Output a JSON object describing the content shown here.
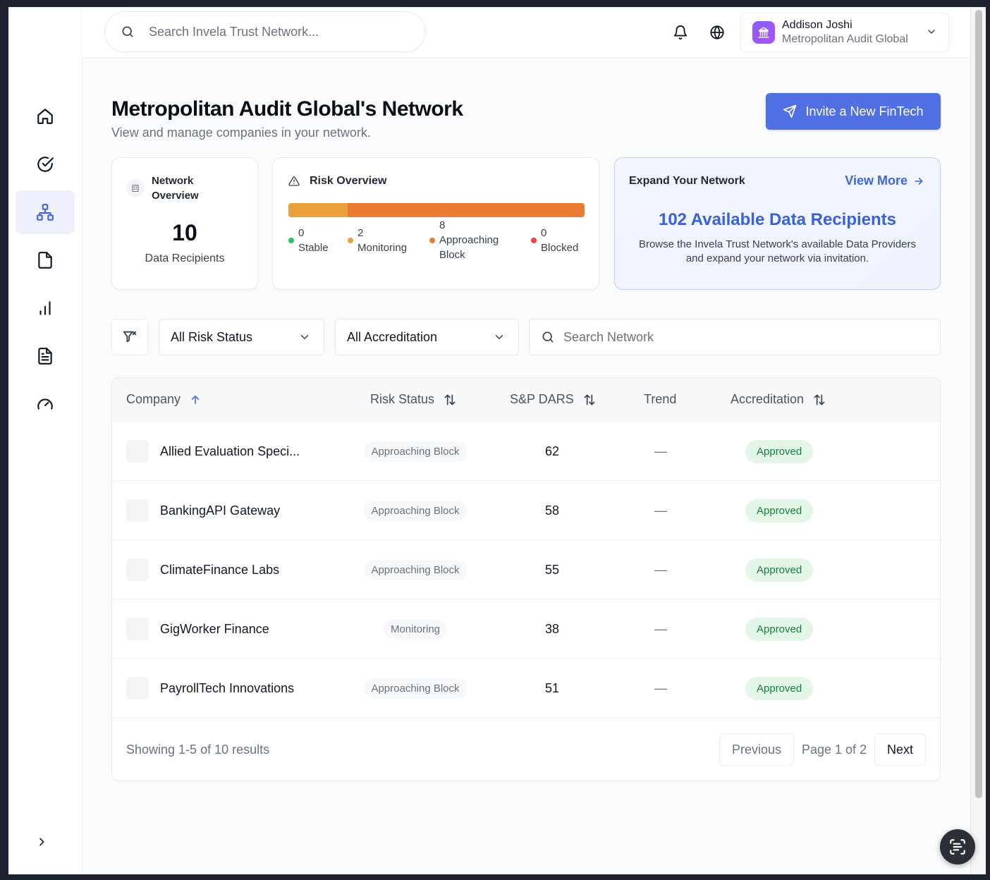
{
  "header": {
    "search_placeholder": "Search Invela Trust Network...",
    "user": {
      "name": "Addison Joshi",
      "org": "Metropolitan Audit Global"
    }
  },
  "sidebar": {
    "items": [
      {
        "icon": "home-icon",
        "active": false
      },
      {
        "icon": "check-circle-icon",
        "active": false
      },
      {
        "icon": "network-icon",
        "active": true
      },
      {
        "icon": "file-icon",
        "active": false
      },
      {
        "icon": "bar-chart-icon",
        "active": false
      },
      {
        "icon": "document-text-icon",
        "active": false
      },
      {
        "icon": "gauge-icon",
        "active": false
      }
    ]
  },
  "page": {
    "title": "Metropolitan Audit Global's Network",
    "subtitle": "View and manage companies in your network.",
    "invite_label": "Invite a New FinTech"
  },
  "network_overview": {
    "title_line1": "Network",
    "title_line2": "Overview",
    "count": "10",
    "label": "Data Recipients"
  },
  "risk_overview": {
    "title": "Risk Overview",
    "bar": [
      {
        "status": "Monitoring",
        "fraction": 0.2,
        "color": "#e9a23b"
      },
      {
        "status": "Approaching Block",
        "fraction": 0.8,
        "color": "#ea7b34"
      }
    ],
    "legend": [
      {
        "count": "0",
        "label": "Stable",
        "color": "#22c55e"
      },
      {
        "count": "2",
        "label": "Monitoring",
        "color": "#e9a23b"
      },
      {
        "count": "8",
        "label": "Approaching Block",
        "color": "#ea7b34"
      },
      {
        "count": "0",
        "label": "Blocked",
        "color": "#ef4444"
      }
    ]
  },
  "expand": {
    "title": "Expand Your Network",
    "view_more": "View More",
    "headline": "102 Available Data Recipients",
    "description": "Browse the Invela Trust Network's available Data Providers and expand your network via invitation."
  },
  "filters": {
    "risk_status": "All Risk Status",
    "accreditation": "All Accreditation",
    "search_placeholder": "Search Network"
  },
  "table": {
    "columns": {
      "company": "Company",
      "risk_status": "Risk Status",
      "dars": "S&P DARS",
      "trend": "Trend",
      "accreditation": "Accreditation"
    },
    "rows": [
      {
        "company": "Allied Evaluation Speci...",
        "risk": "Approaching Block",
        "dars": "62",
        "trend": "—",
        "accreditation": "Approved"
      },
      {
        "company": "BankingAPI Gateway",
        "risk": "Approaching Block",
        "dars": "58",
        "trend": "—",
        "accreditation": "Approved"
      },
      {
        "company": "ClimateFinance Labs",
        "risk": "Approaching Block",
        "dars": "55",
        "trend": "—",
        "accreditation": "Approved"
      },
      {
        "company": "GigWorker Finance",
        "risk": "Monitoring",
        "dars": "38",
        "trend": "—",
        "accreditation": "Approved"
      },
      {
        "company": "PayrollTech Innovations",
        "risk": "Approaching Block",
        "dars": "51",
        "trend": "—",
        "accreditation": "Approved"
      }
    ]
  },
  "pagination": {
    "info": "Showing 1-5 of 10 results",
    "previous": "Previous",
    "page_label": "Page 1 of 2",
    "next": "Next"
  },
  "colors": {
    "accent": "#4f6fe3",
    "link": "#3f66dd",
    "approved_bg": "#e3f6e8",
    "approved_text": "#15803d"
  }
}
